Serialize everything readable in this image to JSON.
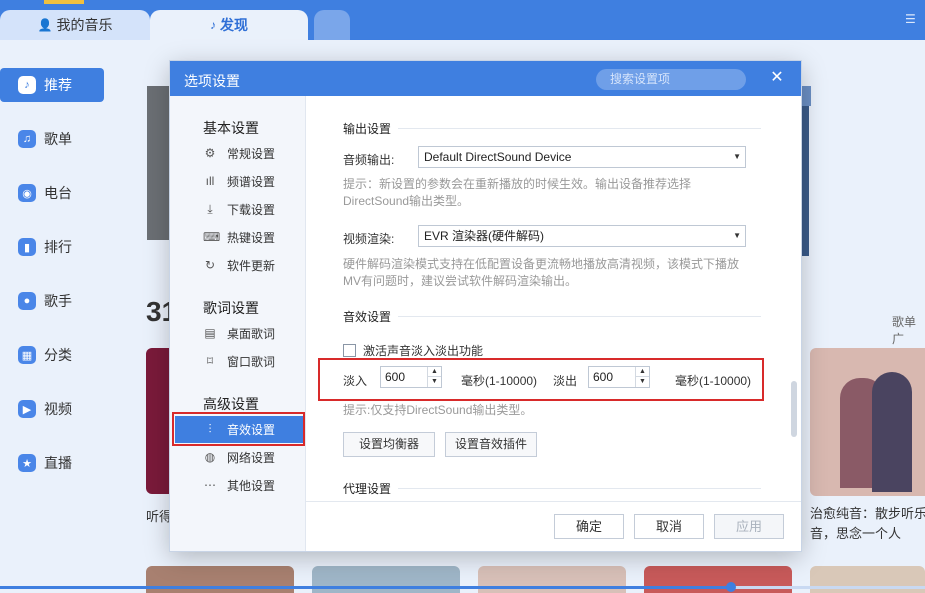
{
  "app": {
    "tabs": [
      {
        "label": "我的音乐",
        "icon": "user-icon"
      },
      {
        "label": "发现",
        "icon": "music-note-icon"
      }
    ],
    "nav": [
      {
        "label": "推荐",
        "icon": "music-note-icon"
      },
      {
        "label": "歌单",
        "icon": "playlist-icon"
      },
      {
        "label": "电台",
        "icon": "radio-icon"
      },
      {
        "label": "排行",
        "icon": "chart-icon"
      },
      {
        "label": "歌手",
        "icon": "user-icon"
      },
      {
        "label": "分类",
        "icon": "grid-icon"
      },
      {
        "label": "视频",
        "icon": "video-icon"
      },
      {
        "label": "直播",
        "icon": "star-icon"
      }
    ],
    "section_number": "31",
    "gedan_label": "歌单广",
    "card_left_caption": "听得",
    "card_right_caption_line1": "治愈纯音：散步听乐",
    "card_right_caption_line2": "音，思念一个人",
    "playback_progress_fraction": 0.79
  },
  "dialog": {
    "title": "选项设置",
    "search_placeholder": "搜索设置项",
    "close_glyph": "✕",
    "groups": [
      {
        "title": "基本设置",
        "items": [
          "常规设置",
          "频谱设置",
          "下载设置",
          "热键设置",
          "软件更新"
        ]
      },
      {
        "title": "歌词设置",
        "items": [
          "桌面歌词",
          "窗口歌词"
        ]
      },
      {
        "title": "高级设置",
        "items": [
          "音效设置",
          "网络设置",
          "其他设置"
        ]
      }
    ],
    "active_item": "音效设置",
    "output": {
      "section_title": "输出设置",
      "audio_label": "音频输出:",
      "audio_value": "Default DirectSound Device",
      "audio_hint": "提示：新设置的参数会在重新播放的时候生效。输出设备推荐选择DirectSound输出类型。",
      "video_label": "视频渲染:",
      "video_value": "EVR 渲染器(硬件解码)",
      "video_hint": "硬件解码渲染模式支持在低配置设备更流畅地播放高清视频，该模式下播放MV有问题时，建议尝试软件解码渲染输出。"
    },
    "effects": {
      "section_title": "音效设置",
      "fade_checkbox_label": "激活声音淡入淡出功能",
      "fade_checked": false,
      "fade_in_label": "淡入",
      "fade_in_value": "600",
      "fade_in_unit": "毫秒(1-10000)",
      "fade_out_label": "淡出",
      "fade_out_value": "600",
      "fade_out_unit": "毫秒(1-10000)",
      "fade_hint": "提示:仅支持DirectSound输出类型。",
      "equalizer_button": "设置均衡器",
      "plugin_button": "设置音效插件"
    },
    "proxy": {
      "section_title": "代理设置"
    },
    "footer": {
      "ok": "确定",
      "cancel": "取消",
      "apply": "应用"
    },
    "colors": {
      "accent": "#3f7fe0",
      "highlight": "#d82a2a"
    }
  }
}
